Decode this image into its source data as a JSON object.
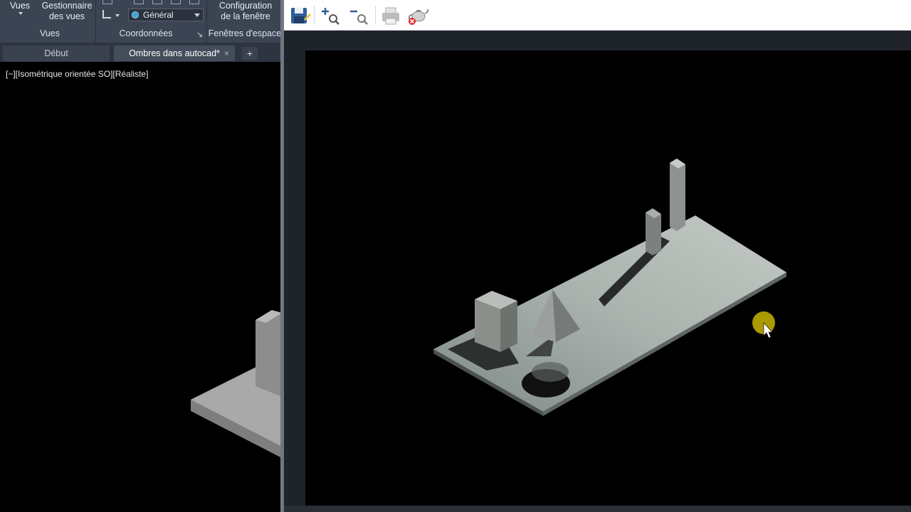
{
  "ribbon": {
    "vues_top": "Vues",
    "gestionnaire_line1": "Gestionnaire",
    "gestionnaire_line2": "des vues",
    "ucs_combo_value": "Général",
    "config_line1": "Configuration",
    "config_line2": "de la fenêtre",
    "panel_vues": "Vues",
    "panel_coordonnees": "Coordonnées",
    "panel_fenetres": "Fenêtres d'espace"
  },
  "tabs": {
    "start": "Début",
    "document": "Ombres dans autocad*",
    "close_glyph": "×",
    "add_glyph": "+"
  },
  "viewport": {
    "label": "[−][Isométrique orientée SO][Réaliste]"
  },
  "preview_toolbar": {
    "icons": [
      "save-icon",
      "zoom-in-icon",
      "zoom-out-icon",
      "print-icon",
      "close-preview-icon"
    ]
  },
  "colors": {
    "ribbon_bg": "#3b4453",
    "tab_bar_bg": "#2e3540",
    "canvas_bg": "#000000",
    "cursor_highlight": "#c8b400"
  }
}
